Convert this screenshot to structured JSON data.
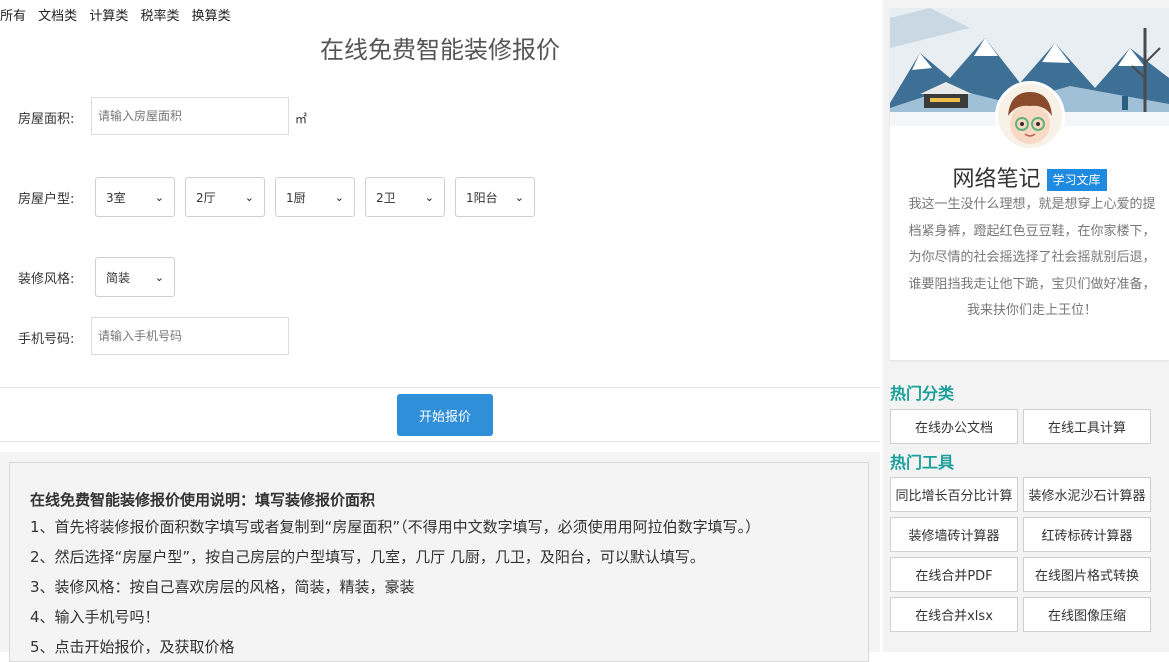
{
  "nav": [
    "所有",
    "文档类",
    "计算类",
    "税率类",
    "换算类"
  ],
  "title": "在线免费智能装修报价",
  "form": {
    "area_label": "房屋面积:",
    "area_placeholder": "请输入房屋面积",
    "area_unit": "㎡",
    "layout_label": "房屋户型:",
    "rooms": "3室",
    "halls": "2厅",
    "kitchens": "1厨",
    "baths": "2卫",
    "balconies": "1阳台",
    "style_label": "装修风格:",
    "style": "简装",
    "phone_label": "手机号码:",
    "phone_placeholder": "请输入手机号码",
    "submit": "开始报价"
  },
  "instructions": {
    "heading": "在线免费智能装修报价使用说明：填写装修报价面积",
    "lines": [
      "1、首先将装修报价面积数字填写或者复制到“房屋面积”（不得用中文数字填写，必须使用用阿拉伯数字填写。）",
      "2、然后选择“房屋户型”，按自己房层的户型填写，几室，几厅 几厨，几卫，及阳台，可以默认填写。",
      "3、装修风格：按自己喜欢房层的风格，简装，精装，豪装",
      "4、输入手机号吗！",
      "5、点击开始报价，及获取价格"
    ]
  },
  "sidebar": {
    "brand": "网络笔记",
    "badge": "学习文库",
    "bio": "我这一生没什么理想，就是想穿上心爱的提档紧身裤，蹬起红色豆豆鞋，在你家楼下，为你尽情的社会摇选择了社会摇就别后退，谁要阻挡我走让他下跪，宝贝们做好准备，我来扶你们走上王位！",
    "hot_categories_title": "热门分类",
    "hot_categories": [
      "在线办公文档",
      "在线工具计算"
    ],
    "hot_tools_title": "热门工具",
    "hot_tools": [
      "同比增长百分比计算",
      "装修水泥沙石计算器",
      "装修墙砖计算器",
      "红砖标砖计算器",
      "在线合并PDF",
      "在线图片格式转换",
      "在线合并xlsx",
      "在线图像压缩"
    ]
  },
  "colors": {
    "accent_blue": "#2f8fd8",
    "section_teal": "#1a9f99",
    "badge_blue": "#1e8be0"
  }
}
